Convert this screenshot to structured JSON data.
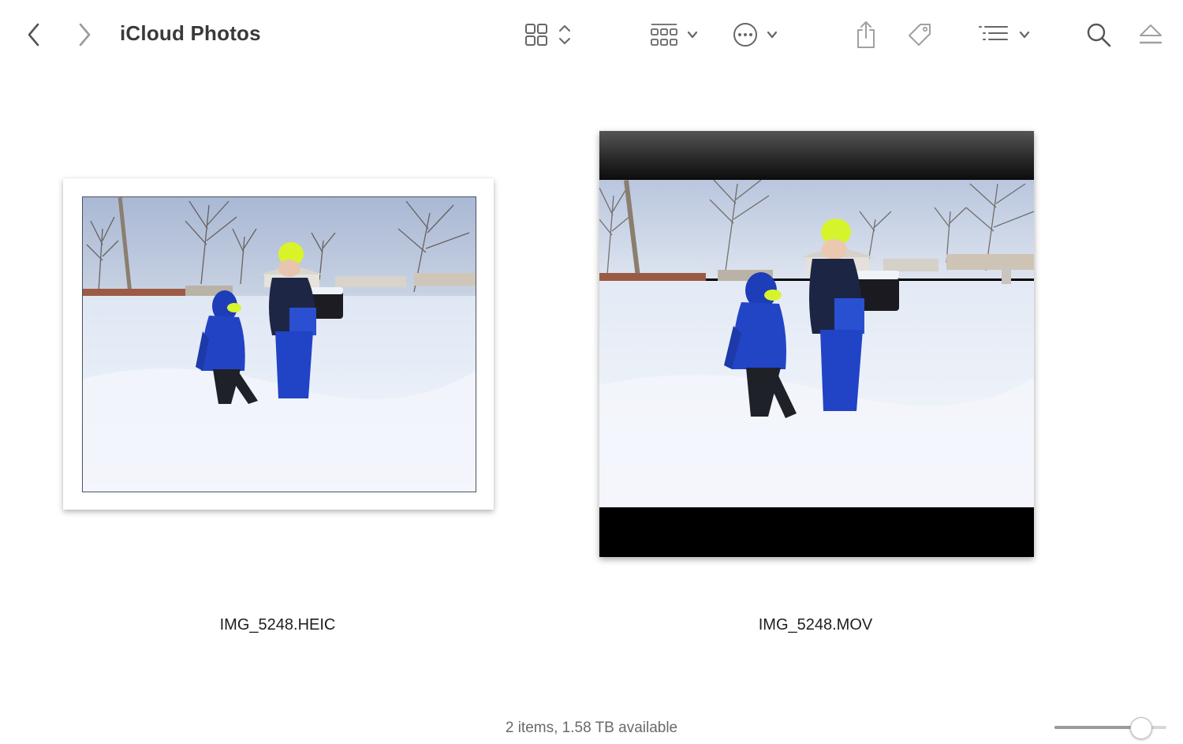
{
  "window": {
    "title": "iCloud Photos"
  },
  "toolbar": {
    "back_icon": "chevron-left-icon",
    "forward_icon": "chevron-right-icon",
    "view_icon": "icon-grid-view-icon",
    "group_icon": "group-by-icon",
    "more_icon": "ellipsis-circle-icon",
    "share_icon": "share-icon",
    "tag_icon": "tag-icon",
    "sort_icon": "list-sort-icon",
    "search_icon": "search-icon",
    "eject_icon": "eject-icon"
  },
  "files": [
    {
      "name": "IMG_5248.HEIC",
      "kind": "photo"
    },
    {
      "name": "IMG_5248.MOV",
      "kind": "video"
    }
  ],
  "status": {
    "text": "2 items, 1.58 TB available"
  },
  "zoom_slider": {
    "value": 0.77
  },
  "colors": {
    "toolbar_icon": "#7a7a7a",
    "snow": "#eef3fb",
    "jacket_blue": "#1f3fb0",
    "hat_green": "#d6f52a"
  }
}
